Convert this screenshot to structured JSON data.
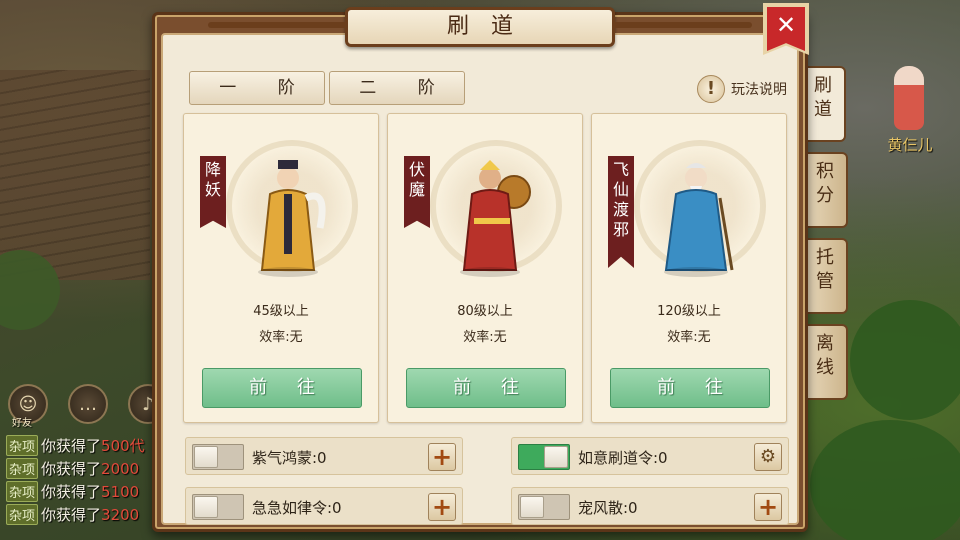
{
  "dialog": {
    "title": "刷道",
    "close_label": "✕"
  },
  "tiers": [
    "一 阶",
    "二 阶"
  ],
  "help_label": "玩法说明",
  "help_icon": "!",
  "cards": [
    {
      "banner": "降妖",
      "level": "45级以上",
      "efficiency": "效率:无",
      "button": "前 往",
      "robe": "#e3a93a",
      "trim": "#2d2a3a"
    },
    {
      "banner": "伏魔",
      "level": "80级以上",
      "efficiency": "效率:无",
      "button": "前 往",
      "robe": "#b8322a",
      "trim": "#f0c84a"
    },
    {
      "banner": "飞仙渡邪",
      "level": "120级以上",
      "efficiency": "效率:无",
      "button": "前 往",
      "robe": "#3a8ec4",
      "trim": "#e6e6e6"
    }
  ],
  "items": [
    {
      "label": "紫气鸿蒙:0",
      "enabled": false,
      "action_icon": "plus-icon",
      "action": "+"
    },
    {
      "label": "如意刷道令:0",
      "enabled": true,
      "action_icon": "gear-icon",
      "action": "⚙"
    },
    {
      "label": "急急如律令:0",
      "enabled": false,
      "action_icon": "plus-icon",
      "action": "+"
    },
    {
      "label": "宠风散:0",
      "enabled": false,
      "action_icon": "plus-icon",
      "action": "+"
    }
  ],
  "side_tabs": [
    {
      "label": "刷道",
      "active": true
    },
    {
      "label": "积分",
      "active": false
    },
    {
      "label": "托管",
      "active": false
    },
    {
      "label": "离线",
      "active": false
    }
  ],
  "npc_name": "黄仨儿",
  "friend_label": "好友",
  "chat_lines": [
    {
      "tag": "杂项",
      "text": "你获得了",
      "num": "500代"
    },
    {
      "tag": "杂项",
      "text": "你获得了",
      "num": "2000"
    },
    {
      "tag": "杂项",
      "text": "你获得了",
      "num": "5100"
    },
    {
      "tag": "杂项",
      "text": "你获得了",
      "num": "3200"
    }
  ],
  "colors": {
    "accent_green": "#6fbe8a",
    "toggle_on": "#3eaa5c",
    "close_red": "#c8282a",
    "frame_brown": "#7a4e2e"
  }
}
